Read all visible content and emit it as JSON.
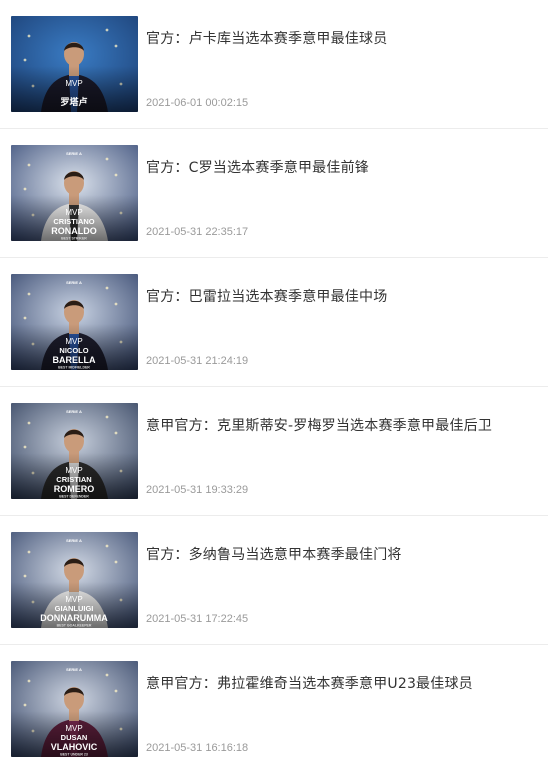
{
  "news": [
    {
      "title": "官方：卢卡库当选本赛季意甲最佳球员",
      "time": "2021-06-01 00:02:15",
      "thumb": {
        "top_text": "",
        "mvp": "MVP",
        "first": "",
        "last": "罗塔卢",
        "sub": "",
        "bg1": "#3a7cc4",
        "bg2": "#1c3f74",
        "jersey": "#1a1a2a",
        "stripe": "#2b5fb3"
      }
    },
    {
      "title": "官方：C罗当选本赛季意甲最佳前锋",
      "time": "2021-05-31 22:35:17",
      "thumb": {
        "top_text": "SERIE A",
        "mvp": "MVP",
        "first": "CRISTIANO",
        "last": "RONALDO",
        "sub": "BEST STRIKER",
        "bg1": "#dbe2ec",
        "bg2": "#3c4f7a",
        "jersey": "#f2f2f2",
        "stripe": "#111111"
      }
    },
    {
      "title": "官方：巴雷拉当选本赛季意甲最佳中场",
      "time": "2021-05-31 21:24:19",
      "thumb": {
        "top_text": "SERIE A",
        "mvp": "MVP",
        "first": "NICOLO",
        "last": "BARELLA",
        "sub": "BEST MIDFIELDER",
        "bg1": "#c9d3e3",
        "bg2": "#35466d",
        "jersey": "#1d1d2d",
        "stripe": "#2a5bb0"
      }
    },
    {
      "title": "意甲官方：克里斯蒂安-罗梅罗当选本赛季意甲最佳后卫",
      "time": "2021-05-31 19:33:29",
      "thumb": {
        "top_text": "SERIE A",
        "mvp": "MVP",
        "first": "CRISTIAN",
        "last": "ROMERO",
        "sub": "BEST DEFENDER",
        "bg1": "#c7cfdc",
        "bg2": "#33425f",
        "jersey": "#2a2a2a",
        "stripe": "#f0f0f0"
      }
    },
    {
      "title": "官方：多纳鲁马当选意甲本赛季最佳门将",
      "time": "2021-05-31 17:22:45",
      "thumb": {
        "top_text": "SERIE A",
        "mvp": "MVP",
        "first": "GIANLUIGI",
        "last": "DONNARUMMA",
        "sub": "BEST GOALKEEPER",
        "bg1": "#d4dbe6",
        "bg2": "#3a4b70",
        "jersey": "#eeeeee",
        "stripe": "#c9c9c9"
      }
    },
    {
      "title": "意甲官方：弗拉霍维奇当选本赛季意甲U23最佳球员",
      "time": "2021-05-31 16:16:18",
      "thumb": {
        "top_text": "SERIE A",
        "mvp": "MVP",
        "first": "DUSAN",
        "last": "VLAHOVIC",
        "sub": "BEST UNDER 23",
        "bg1": "#cfd6e2",
        "bg2": "#364668",
        "jersey": "#5a1e3a",
        "stripe": "#7a2a50"
      }
    }
  ]
}
